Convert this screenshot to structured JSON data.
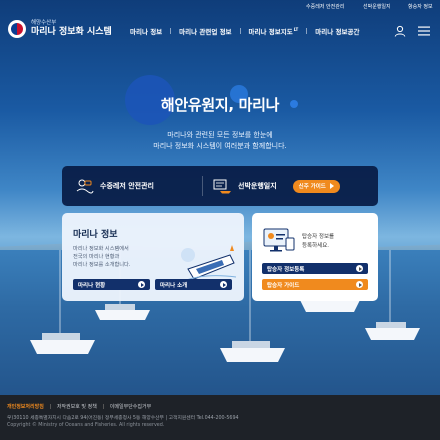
{
  "topbar": {
    "link1": "수중레저 안전관리",
    "link2": "선박운행일지",
    "link3": "항승자 정보"
  },
  "logo": {
    "org": "해양수산부",
    "system": "마리나 정보화 시스템"
  },
  "gnb": {
    "items": [
      "마리나 정보",
      "마리나 관련업 정보",
      "마리나 정보지도",
      "마리나 정보공간"
    ],
    "badge": "LT"
  },
  "hero": {
    "title": "해안유원지, 마리나",
    "sub1": "마리나와 관련된 모든 정보를 한눈에",
    "sub2": "마리나 정보화 시스템이 여러분과 함께합니다."
  },
  "quickbar": {
    "left_label": "수중레저 안전관리",
    "right_label": "선박운행일지",
    "guide_button": "신주 가이드"
  },
  "info_card": {
    "title": "마리나 정보",
    "desc1": "마리나 정보화 시스템에서",
    "desc2": "전국의 마리나 현황과",
    "desc3": "마리나 정보를 소개합니다.",
    "btn_status": "마리나 현황",
    "btn_intro": "마리나 소개"
  },
  "passenger_card": {
    "text1": "탑승자 정보를",
    "text2": "등록하세요.",
    "btn_register": "탑승자 정보등록",
    "btn_guide": "탑승자 가이드"
  },
  "footer": {
    "privacy": "개인정보처리방침",
    "copyright_policy": "저작권보호 및 정책",
    "email_refusal": "이메일무단수집거부",
    "address": "우)30110 세종특별자치시 다솜2로 94(어진동) 정부세종청사 5동 해양수산부   |   고객지원센터 Tel.044-200-5694",
    "copyright": "Copyright © Ministry of Oceans and Fisheries. All rights reserved."
  },
  "colors": {
    "navy": "#12306b",
    "orange": "#f08a1e",
    "footer_bg": "#1e2228"
  }
}
